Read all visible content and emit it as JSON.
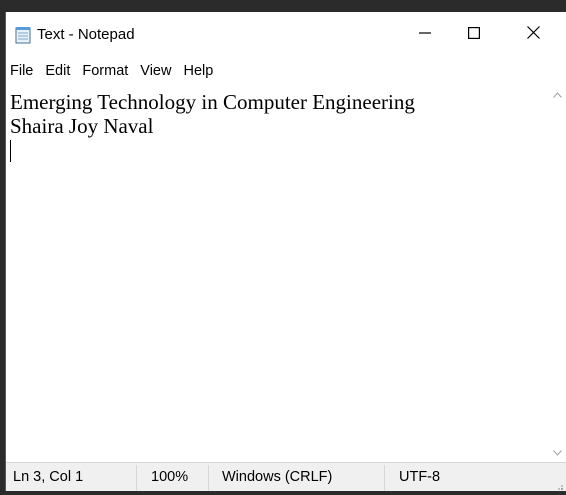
{
  "window": {
    "title": "Text - Notepad",
    "icon": "notepad-icon",
    "controls": {
      "minimize_icon": "minimize-icon",
      "maximize_icon": "maximize-icon",
      "close_icon": "close-icon"
    }
  },
  "menubar": {
    "items": [
      {
        "label": "File"
      },
      {
        "label": "Edit"
      },
      {
        "label": "Format"
      },
      {
        "label": "View"
      },
      {
        "label": "Help"
      }
    ]
  },
  "editor": {
    "lines": [
      "Emerging Technology in Computer Engineering",
      "Shaira Joy Naval"
    ]
  },
  "statusbar": {
    "position": "Ln 3, Col 1",
    "zoom": "100%",
    "line_ending": "Windows (CRLF)",
    "encoding": "UTF-8"
  },
  "colors": {
    "background": "#ffffff",
    "statusbar_bg": "#f0f0f0",
    "text": "#000000"
  }
}
